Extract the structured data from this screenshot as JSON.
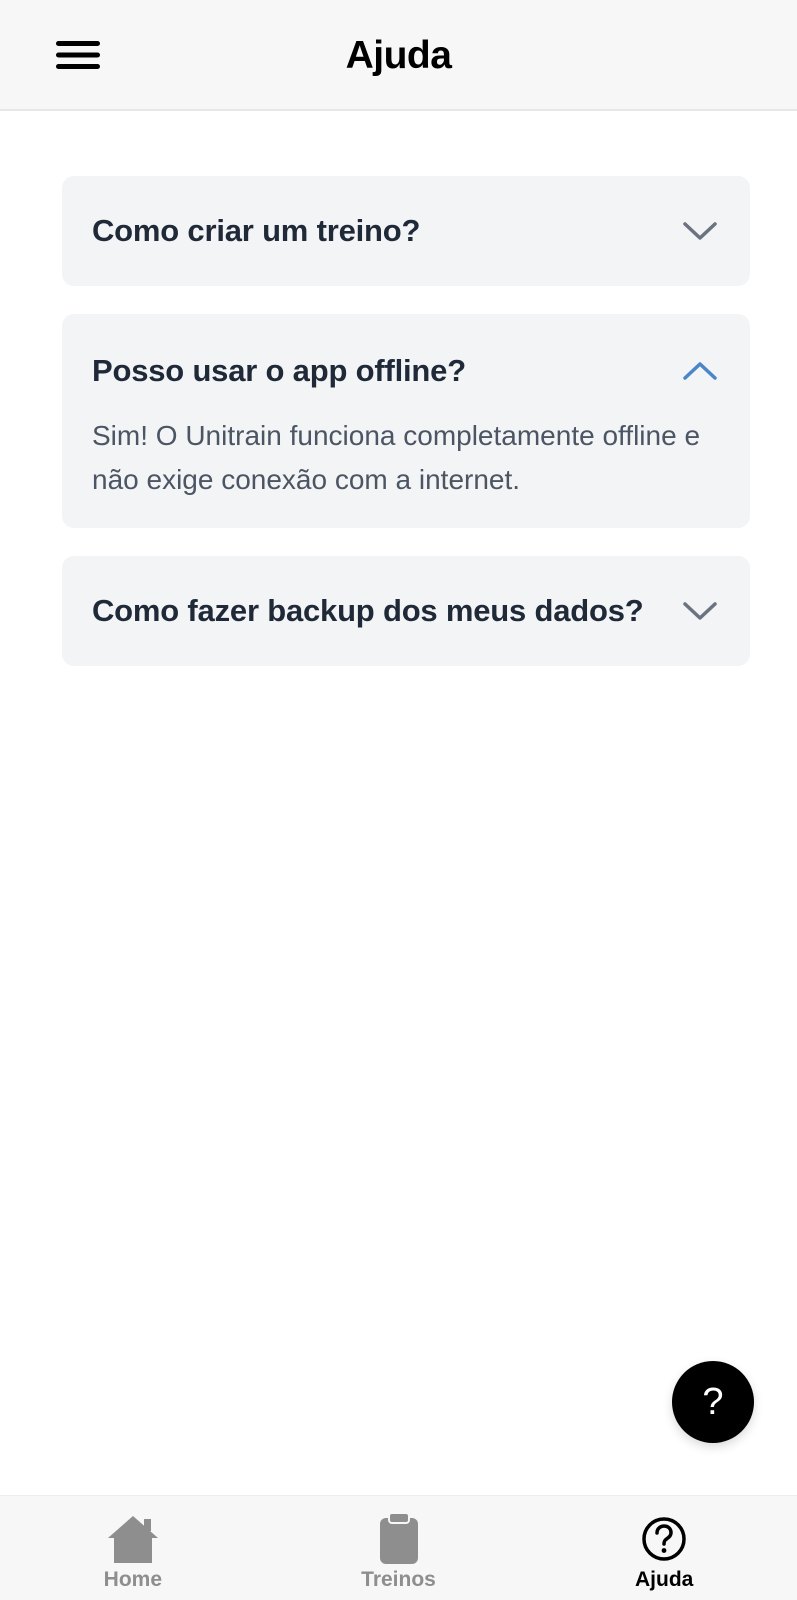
{
  "header": {
    "title": "Ajuda",
    "menu_icon": "hamburger-menu-icon"
  },
  "faq": {
    "items": [
      {
        "question": "Como criar um treino?",
        "answer": "",
        "expanded": false,
        "icon": "chevron-down-icon"
      },
      {
        "question": "Posso usar o app offline?",
        "answer": "Sim! O Unitrain funciona completamente offline e não exige conexão com a internet.",
        "expanded": true,
        "icon": "chevron-up-icon"
      },
      {
        "question": "Como fazer backup dos meus dados?",
        "answer": "",
        "expanded": false,
        "icon": "chevron-down-icon"
      }
    ]
  },
  "fab": {
    "label": "?",
    "icon": "help-icon"
  },
  "bottom_nav": {
    "items": [
      {
        "label": "Home",
        "icon": "home-icon",
        "active": false
      },
      {
        "label": "Treinos",
        "icon": "clipboard-icon",
        "active": false
      },
      {
        "label": "Ajuda",
        "icon": "help-circle-icon",
        "active": true
      }
    ]
  },
  "colors": {
    "header_bg": "#f7f7f7",
    "card_bg": "#f3f4f6",
    "title_text": "#000000",
    "question_text": "#1f2937",
    "answer_text": "#4b5563",
    "chevron_gray": "#6b7280",
    "chevron_active": "#4a86c8",
    "nav_inactive": "#8e8e8e",
    "nav_active": "#000000",
    "fab_bg": "#000000"
  }
}
